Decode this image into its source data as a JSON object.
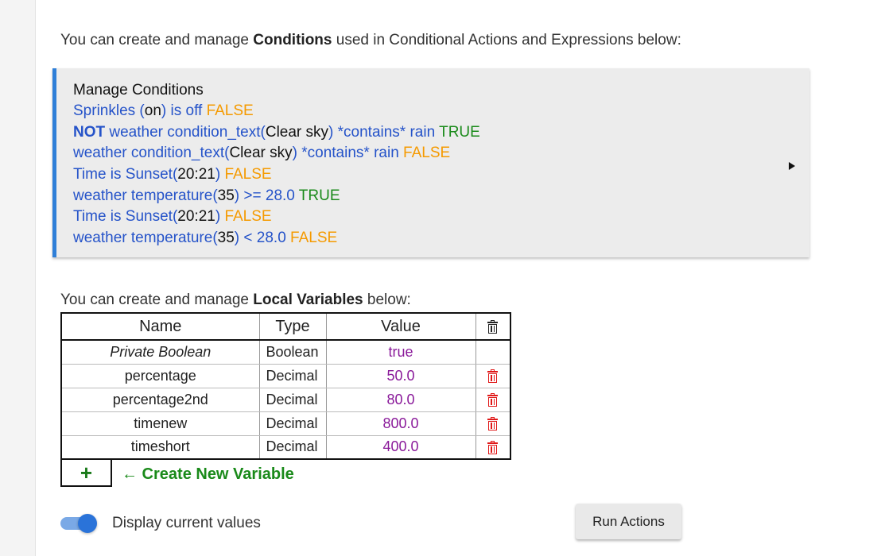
{
  "conditions_intro": {
    "prefix": "You can create and manage ",
    "bold": "Conditions",
    "suffix": " used in Conditional Actions and Expressions below:"
  },
  "conditions_panel": {
    "title": "Manage Conditions",
    "lines": [
      {
        "segments": [
          {
            "text": "Sprinkles (",
            "style": "blue"
          },
          {
            "text": "on",
            "style": "dark"
          },
          {
            "text": ") is off ",
            "style": "blue"
          },
          {
            "text": "FALSE",
            "style": "false"
          }
        ]
      },
      {
        "segments": [
          {
            "text": "NOT",
            "style": "notkw"
          },
          {
            "text": " weather condition_text(",
            "style": "blue"
          },
          {
            "text": "Clear sky",
            "style": "dark"
          },
          {
            "text": ") *contains* rain ",
            "style": "blue"
          },
          {
            "text": "TRUE",
            "style": "true"
          }
        ]
      },
      {
        "segments": [
          {
            "text": "weather condition_text(",
            "style": "blue"
          },
          {
            "text": "Clear sky",
            "style": "dark"
          },
          {
            "text": ") *contains* rain ",
            "style": "blue"
          },
          {
            "text": "FALSE",
            "style": "false"
          }
        ]
      },
      {
        "segments": [
          {
            "text": "Time is Sunset(",
            "style": "blue"
          },
          {
            "text": "20:21",
            "style": "dark"
          },
          {
            "text": ") ",
            "style": "blue"
          },
          {
            "text": "FALSE",
            "style": "false"
          }
        ]
      },
      {
        "segments": [
          {
            "text": "weather temperature(",
            "style": "blue"
          },
          {
            "text": "35",
            "style": "dark"
          },
          {
            "text": ") >= 28.0 ",
            "style": "blue"
          },
          {
            "text": "TRUE",
            "style": "true"
          }
        ]
      },
      {
        "segments": [
          {
            "text": "Time is Sunset(",
            "style": "blue"
          },
          {
            "text": "20:21",
            "style": "dark"
          },
          {
            "text": ") ",
            "style": "blue"
          },
          {
            "text": "FALSE",
            "style": "false"
          }
        ]
      },
      {
        "segments": [
          {
            "text": "weather temperature(",
            "style": "blue"
          },
          {
            "text": "35",
            "style": "dark"
          },
          {
            "text": ") < 28.0 ",
            "style": "blue"
          },
          {
            "text": "FALSE",
            "style": "false"
          }
        ]
      }
    ],
    "expand_icon": "triangle-right-icon"
  },
  "variables_intro": {
    "prefix": "You can create and manage ",
    "bold": "Local Variables",
    "suffix": " below:"
  },
  "variables_table": {
    "headers": {
      "name": "Name",
      "type": "Type",
      "value": "Value",
      "delete_icon": "trash-icon"
    },
    "rows": [
      {
        "name": "Private Boolean",
        "type": "Boolean",
        "value": "true",
        "italic": true,
        "deletable": false
      },
      {
        "name": "percentage",
        "type": "Decimal",
        "value": "50.0",
        "italic": false,
        "deletable": true
      },
      {
        "name": "percentage2nd",
        "type": "Decimal",
        "value": "80.0",
        "italic": false,
        "deletable": true
      },
      {
        "name": "timenew",
        "type": "Decimal",
        "value": "800.0",
        "italic": false,
        "deletable": true
      },
      {
        "name": "timeshort",
        "type": "Decimal",
        "value": "400.0",
        "italic": false,
        "deletable": true
      }
    ]
  },
  "add_variable": {
    "button_label": "+",
    "create_label": "← Create New Variable"
  },
  "display_toggle": {
    "label": "Display current values",
    "checked": true
  },
  "run_button": {
    "label": "Run Actions"
  },
  "colors": {
    "accent_blue": "#2f7fd8",
    "condition_blue": "#2553c9",
    "false_orange": "#f59a00",
    "true_green": "#1a8a1a",
    "value_purple": "#8a1a9a",
    "delete_red": "#e01818"
  }
}
